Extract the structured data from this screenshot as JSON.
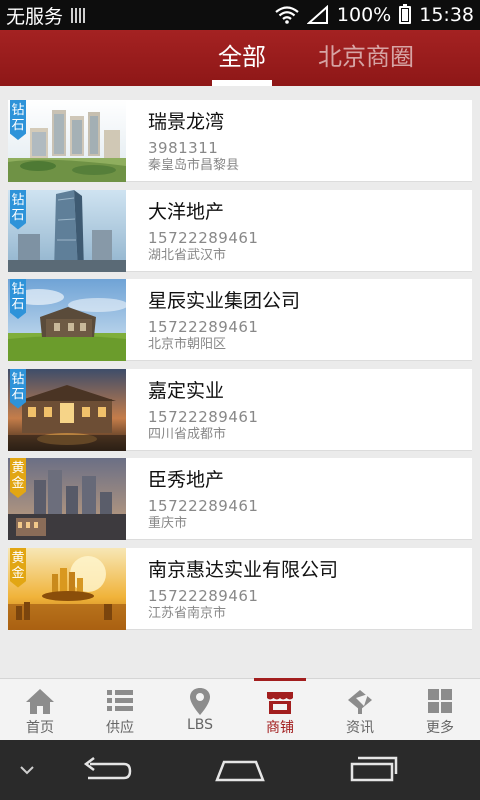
{
  "status": {
    "carrier": "无服务",
    "battery": "100%",
    "time": "15:38"
  },
  "tabs": [
    {
      "label": "全部",
      "active": true
    },
    {
      "label": "北京商圈",
      "active": false
    }
  ],
  "listings": [
    {
      "badge": "钻石",
      "tier": "diamond",
      "name": "瑞景龙湾",
      "phone": "3981311",
      "location": "秦皇岛市昌黎县",
      "image": "apartment-complex-rendering"
    },
    {
      "badge": "钻石",
      "tier": "diamond",
      "name": "大洋地产",
      "phone": "15722289461",
      "location": "湖北省武汉市",
      "image": "glass-skyscraper"
    },
    {
      "badge": "钻石",
      "tier": "diamond",
      "name": "星辰实业集团公司",
      "phone": "15722289461",
      "location": "北京市朝阳区",
      "image": "house-on-grassland"
    },
    {
      "badge": "钻石",
      "tier": "diamond",
      "name": "嘉定实业",
      "phone": "15722289461",
      "location": "四川省成都市",
      "image": "villa-at-dusk"
    },
    {
      "badge": "黄金",
      "tier": "gold",
      "name": "臣秀地产",
      "phone": "15722289461",
      "location": "重庆市",
      "image": "city-skyline-dusk"
    },
    {
      "badge": "黄金",
      "tier": "gold",
      "name": "南京惠达实业有限公司",
      "phone": "15722289461",
      "location": "江苏省南京市",
      "image": "golden-city-model"
    }
  ],
  "bottom_nav": [
    {
      "label": "首页",
      "icon": "home-icon"
    },
    {
      "label": "供应",
      "icon": "list-icon"
    },
    {
      "label": "LBS",
      "icon": "location-pin-icon"
    },
    {
      "label": "商铺",
      "icon": "shop-icon",
      "active": true
    },
    {
      "label": "资讯",
      "icon": "news-icon"
    },
    {
      "label": "更多",
      "icon": "grid-icon"
    }
  ],
  "colors": {
    "brand": "#9b1c1c",
    "diamond_badge": "#2e93d9",
    "gold_badge": "#e2a613"
  }
}
